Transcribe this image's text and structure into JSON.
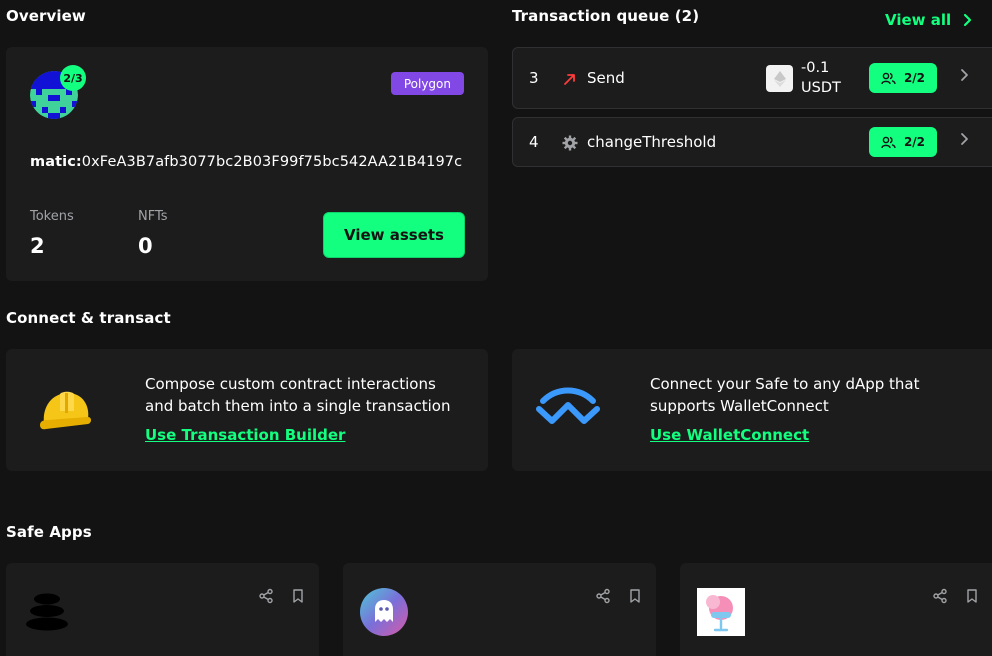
{
  "overview": {
    "title": "Overview",
    "threshold": "2/3",
    "network": "Polygon",
    "address_prefix": "matic:",
    "address": "0xFeA3B7afb3077bc2B03F99f75bc542AA21B4197c",
    "tokens_label": "Tokens",
    "tokens_value": "2",
    "nfts_label": "NFTs",
    "nfts_value": "0",
    "view_assets_label": "View assets"
  },
  "queue": {
    "title": "Transaction queue (2)",
    "view_all_label": "View all",
    "items": [
      {
        "nonce": "3",
        "label": "Send",
        "amount": "-0.1",
        "token": "USDT",
        "confirmations": "2/2",
        "icon": "arrow-outgoing-icon"
      },
      {
        "nonce": "4",
        "label": "changeThreshold",
        "confirmations": "2/2",
        "icon": "gear-icon"
      }
    ]
  },
  "connect": {
    "title": "Connect & transact",
    "builder": {
      "text_line1": "Compose custom contract interactions",
      "text_line2": "and batch them into a single transaction",
      "link": "Use Transaction Builder"
    },
    "walletconnect": {
      "text_line1": "Connect your Safe to any dApp that",
      "text_line2": "supports WalletConnect",
      "link": "Use WalletConnect"
    }
  },
  "safe_apps": {
    "title": "Safe Apps"
  },
  "colors": {
    "accent": "#12ff80",
    "background": "#121312",
    "card": "#1c1c1c",
    "polygon": "#8248e5",
    "send_arrow": "#ff3b3b"
  }
}
